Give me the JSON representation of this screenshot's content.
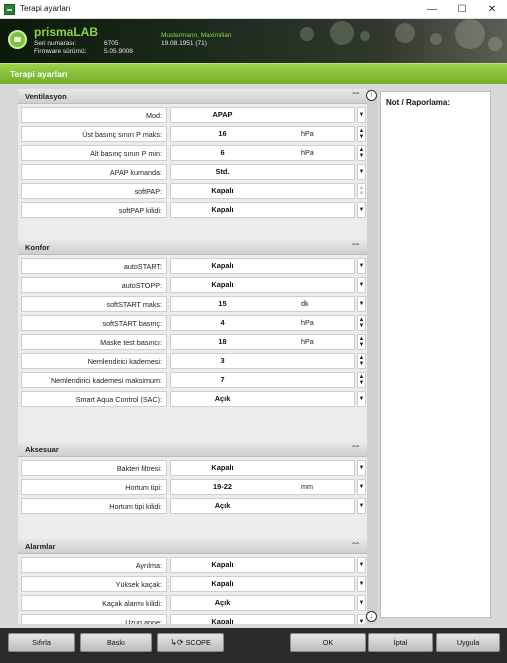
{
  "window": {
    "title": "Terapi ayarları",
    "minimize_glyph": "—",
    "maximize_glyph": "☐",
    "close_glyph": "✕"
  },
  "header": {
    "brand": "prismaLAB",
    "serial_label": "Seri numarası:",
    "serial_value": "6705",
    "firmware_label": "Firmware sürümü:",
    "firmware_value": "5.05.9008",
    "patient_name": "Mustermann, Maximilian",
    "patient_dob": "19.08.1951  (71)"
  },
  "section_title": "Terapi ayarları",
  "icons": {
    "collapse": "chevrons-up-icon",
    "dropdown": "chevron-down-icon",
    "spinner": "spin-up-down-icon",
    "scroll_up": "scroll-up-icon",
    "scroll_down": "scroll-down-icon"
  },
  "groups": {
    "ventilation": {
      "title": "Ventilasyon",
      "rows": [
        {
          "label": "Mod:",
          "value": "APAP",
          "unit": ""
        },
        {
          "label": "Üst basınç sınırı P maks:",
          "value": "16",
          "unit": "hPa"
        },
        {
          "label": "Alt basınç sınırı P min:",
          "value": "6",
          "unit": "hPa"
        },
        {
          "label": "APAP kumanda:",
          "value": "Std.",
          "unit": ""
        },
        {
          "label": "softPAP:",
          "value": "Kapalı",
          "unit": ""
        },
        {
          "label": "softPAP kilidi:",
          "value": "Kapalı",
          "unit": ""
        }
      ]
    },
    "comfort": {
      "title": "Konfor",
      "rows": [
        {
          "label": "autoSTART:",
          "value": "Kapalı",
          "unit": ""
        },
        {
          "label": "autoSTOPP:",
          "value": "Kapalı",
          "unit": ""
        },
        {
          "label": "softSTART maks:",
          "value": "15",
          "unit": "dk"
        },
        {
          "label": "softSTART basınç:",
          "value": "4",
          "unit": "hPa"
        },
        {
          "label": "Maske test basıncı:",
          "value": "18",
          "unit": "hPa"
        },
        {
          "label": "Nemlendirici kademesi:",
          "value": "3",
          "unit": ""
        },
        {
          "label": "Nemlendirici kademesi maksimum:",
          "value": "7",
          "unit": ""
        },
        {
          "label": "Smart Aqua Control (SAC):",
          "value": "Açık",
          "unit": ""
        }
      ]
    },
    "accessories": {
      "title": "Aksesuar",
      "rows": [
        {
          "label": "Bakteri filtresi:",
          "value": "Kapalı",
          "unit": ""
        },
        {
          "label": "Hortum tipi:",
          "value": "19-22",
          "unit": "mm"
        },
        {
          "label": "Hortum tipi kilidi:",
          "value": "Açık",
          "unit": ""
        }
      ]
    },
    "alarms": {
      "title": "Alarmlar",
      "rows": [
        {
          "label": "Ayrılma:",
          "value": "Kapalı",
          "unit": ""
        },
        {
          "label": "Yüksek kaçak:",
          "value": "Kapalı",
          "unit": ""
        },
        {
          "label": "Kaçak alarmı kilidi:",
          "value": "Açık",
          "unit": ""
        },
        {
          "label": "Uzun apne:",
          "value": "Kapalı",
          "unit": ""
        }
      ]
    }
  },
  "notes": {
    "title": "Not / Raporlama:"
  },
  "buttons": {
    "reset": "Sıfırla",
    "print": "Baskı",
    "scope": "SCOPE",
    "ok": "OK",
    "cancel": "İptal",
    "apply": "Uygula"
  },
  "colors": {
    "brand_green": "#8fd14f",
    "section_green": "#7cb83a"
  }
}
